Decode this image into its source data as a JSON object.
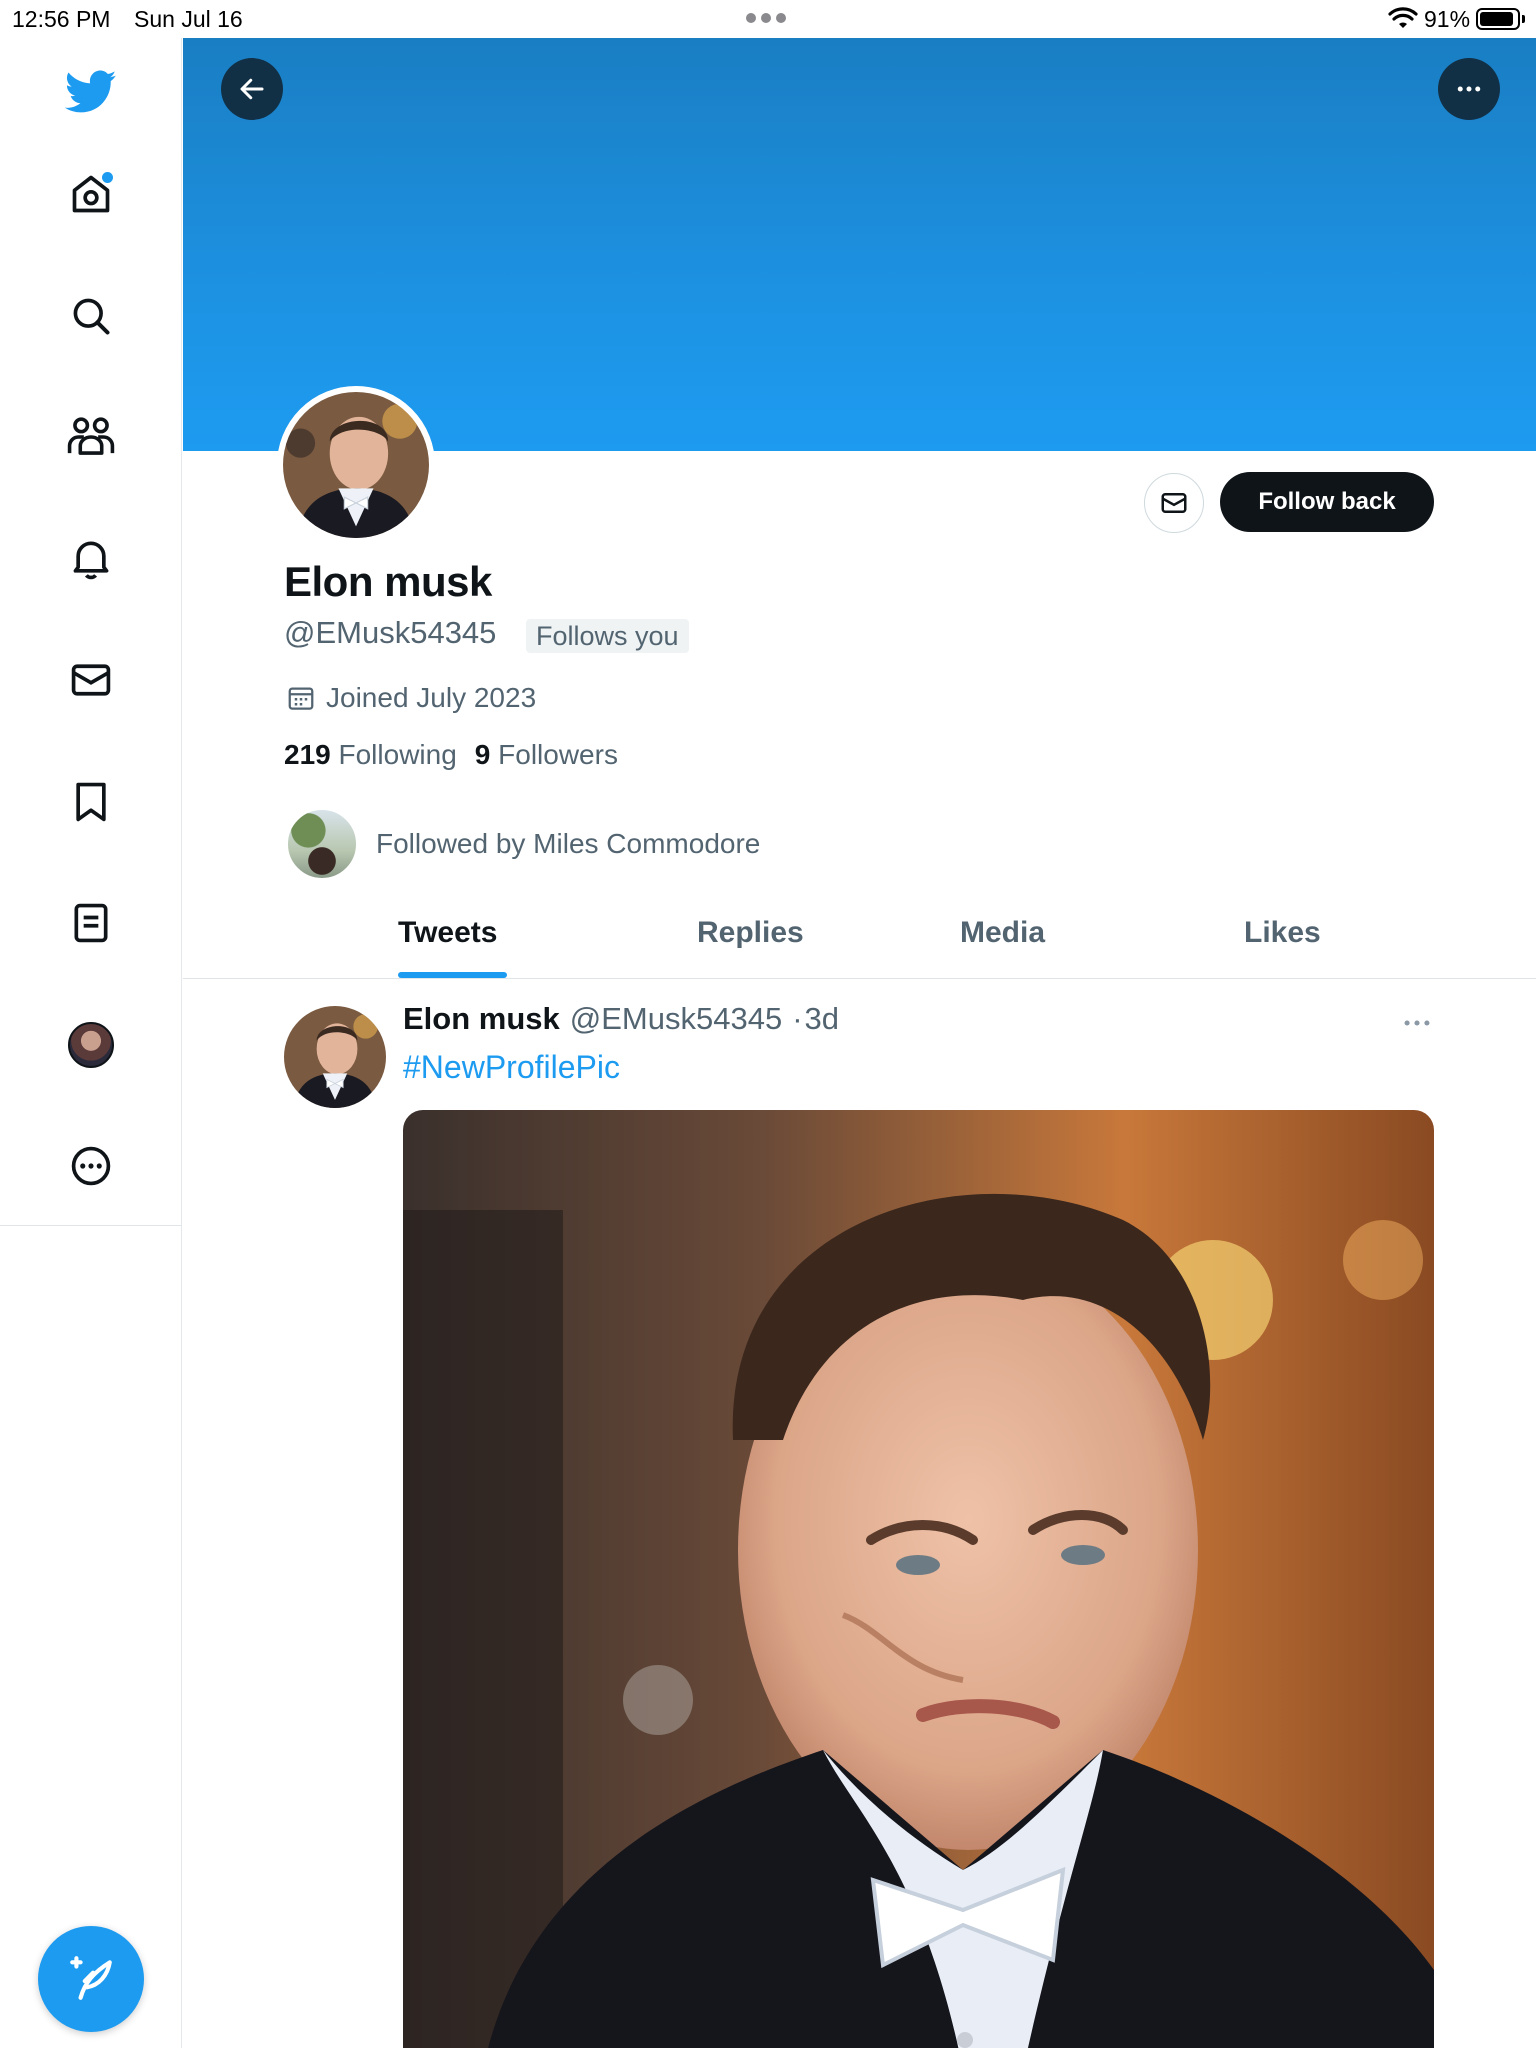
{
  "status_bar": {
    "time": "12:56 PM",
    "date": "Sun Jul 16",
    "battery_pct": "91%"
  },
  "nav": {
    "items": [
      "twitter-logo",
      "home",
      "search",
      "communities",
      "notifications",
      "messages",
      "bookmarks",
      "lists",
      "profile",
      "more"
    ],
    "accent": "#1d9bf0"
  },
  "profile": {
    "display_name": "Elon musk",
    "handle": "@EMusk54345",
    "follows_you": "Follows you",
    "joined": "Joined July 2023",
    "following_count": "219",
    "following_label": "Following",
    "followers_count": "9",
    "followers_label": "Followers",
    "followed_by": "Followed by Miles Commodore",
    "follow_button": "Follow back"
  },
  "tabs": [
    {
      "label": "Tweets",
      "active": true
    },
    {
      "label": "Replies",
      "active": false
    },
    {
      "label": "Media",
      "active": false
    },
    {
      "label": "Likes",
      "active": false
    }
  ],
  "tweet": {
    "name": "Elon musk",
    "handle": "@EMusk54345",
    "separator": "·",
    "age": "3d",
    "text": "#NewProfilePic"
  },
  "colors": {
    "banner": "#1d9bf0",
    "follow_button_bg": "#0f1419",
    "link": "#1d9bf0",
    "muted_text": "#536471"
  }
}
